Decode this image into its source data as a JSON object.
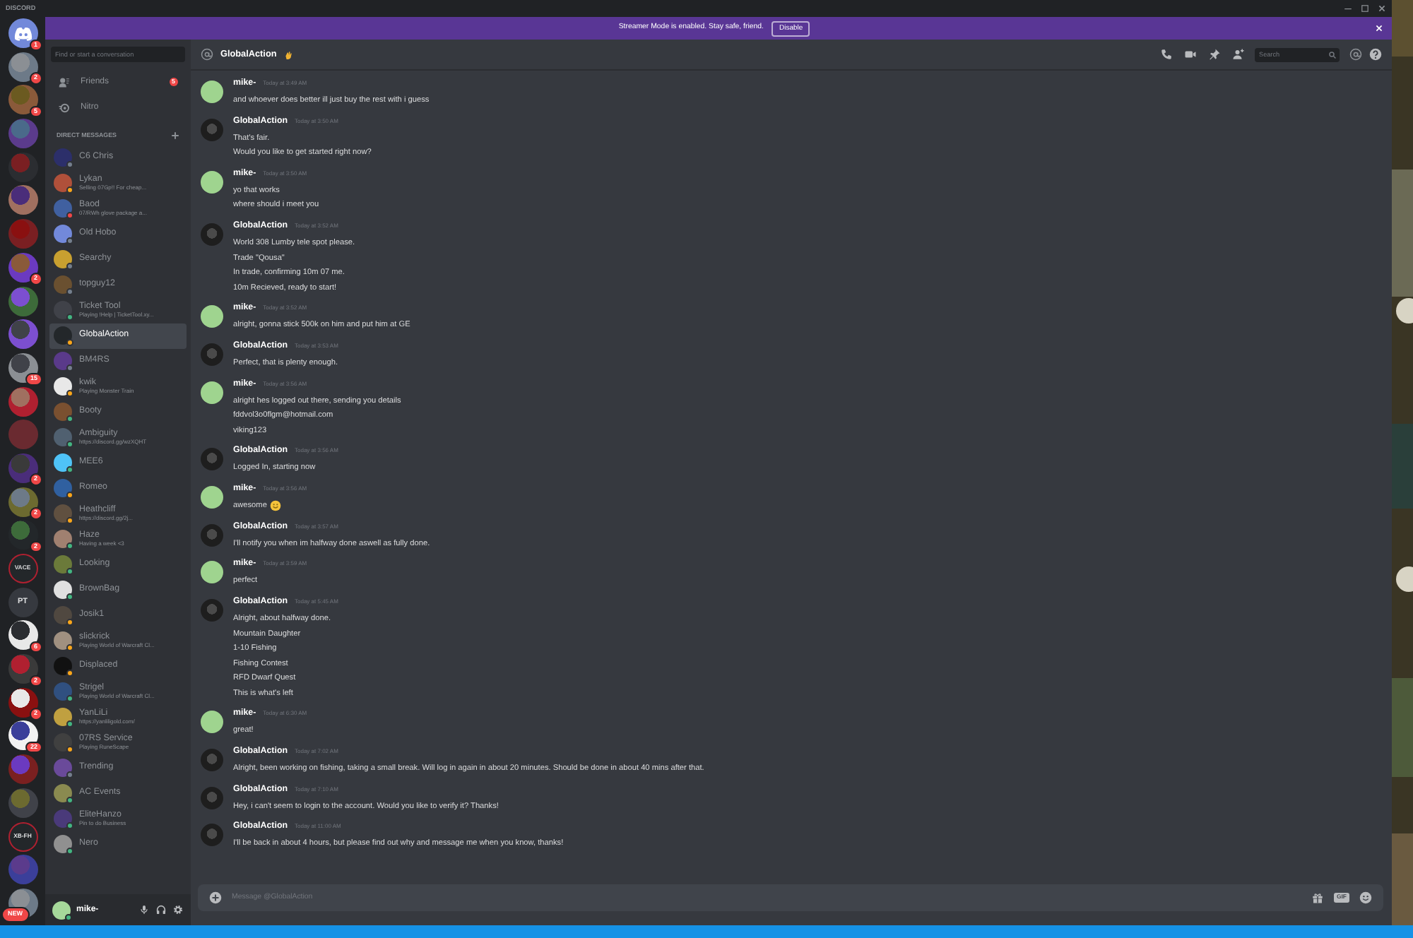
{
  "window": {
    "title": "DISCORD"
  },
  "servers": [
    {
      "kind": "home",
      "badge": "1"
    },
    {
      "kind": "picture",
      "badge": "2"
    },
    {
      "kind": "picture",
      "badge": "5"
    },
    {
      "kind": "picture"
    },
    {
      "kind": "picture"
    },
    {
      "kind": "picture"
    },
    {
      "kind": "picture"
    },
    {
      "kind": "picture",
      "badge": "2"
    },
    {
      "kind": "picture"
    },
    {
      "kind": "picture"
    },
    {
      "kind": "picture",
      "badge": "15"
    },
    {
      "kind": "picture"
    },
    {
      "kind": "picture"
    },
    {
      "kind": "picture",
      "badge": "2"
    },
    {
      "kind": "picture",
      "badge": "2"
    },
    {
      "kind": "picture",
      "badge": "2"
    },
    {
      "kind": "text",
      "label": "VACE"
    },
    {
      "kind": "text",
      "label": "PT"
    },
    {
      "kind": "picture",
      "badge": "6"
    },
    {
      "kind": "picture",
      "badge": "2"
    },
    {
      "kind": "picture",
      "badge": "2"
    },
    {
      "kind": "picture",
      "badge": "22"
    },
    {
      "kind": "picture"
    },
    {
      "kind": "picture"
    },
    {
      "kind": "text",
      "label": "XB-FH"
    },
    {
      "kind": "picture"
    },
    {
      "kind": "picture",
      "badge": "NEW"
    }
  ],
  "banner": {
    "text": "Streamer Mode is enabled. Stay safe, friend.",
    "button": "Disable"
  },
  "search": {
    "placeholder": "Find or start a conversation"
  },
  "nav": [
    {
      "kind": "friends",
      "label": "Friends",
      "badge": "5"
    },
    {
      "kind": "nitro",
      "label": "Nitro"
    }
  ],
  "dm_header": "DIRECT MESSAGES",
  "dms": [
    {
      "name": "C6 Chris",
      "color": "#747f8d",
      "selected": false
    },
    {
      "name": "Lykan",
      "activity": "Selling 07Gp!! For cheap...",
      "color": "#faa61a",
      "selected": false
    },
    {
      "name": "Baod",
      "activity": "07/RWh glove package a...",
      "color": "#f04747",
      "selected": false
    },
    {
      "name": "Old Hobo",
      "color": "#747f8d",
      "selected": false
    },
    {
      "name": "Searchy",
      "color": "#747f8d",
      "selected": false
    },
    {
      "name": "topguy12",
      "color": "#747f8d",
      "selected": false
    },
    {
      "name": "Ticket Tool",
      "activity": "Playing !Help | TicketTool.xy...",
      "color": "#43b581",
      "selected": false
    },
    {
      "name": "GlobalAction",
      "color": "#faa61a",
      "selected": true
    },
    {
      "name": "BM4RS",
      "color": "#747f8d",
      "selected": false
    },
    {
      "name": "kwik",
      "activity": "Playing Monster Train",
      "color": "#faa61a",
      "selected": false
    },
    {
      "name": "Booty",
      "color": "#43b581",
      "selected": false
    },
    {
      "name": "Ambiguity",
      "activity": "https://discord.gg/wzXQHT",
      "color": "#43b581",
      "selected": false
    },
    {
      "name": "MEE6",
      "color": "#43b581",
      "selected": false
    },
    {
      "name": "Romeo",
      "color": "#faa61a",
      "selected": false
    },
    {
      "name": "Heathcliff",
      "activity": "https://discord.gg/2j...",
      "color": "#faa61a",
      "selected": false
    },
    {
      "name": "Haze",
      "activity": "Having a week <3",
      "color": "#43b581",
      "selected": false
    },
    {
      "name": "Looking",
      "color": "#43b581",
      "selected": false
    },
    {
      "name": "BrownBag",
      "color": "#43b581",
      "selected": false
    },
    {
      "name": "Josik1",
      "color": "#faa61a",
      "selected": false
    },
    {
      "name": "slickrick",
      "activity": "Playing World of Warcraft Cl...",
      "color": "#faa61a",
      "selected": false
    },
    {
      "name": "Displaced",
      "color": "#faa61a",
      "selected": false
    },
    {
      "name": "Strigel",
      "activity": "Playing World of Warcraft Cl...",
      "color": "#43b581",
      "selected": false
    },
    {
      "name": "YanLiLi",
      "activity": "https://yanliligold.com/",
      "color": "#43b581",
      "selected": false
    },
    {
      "name": "07RS Service",
      "activity": "Playing RuneScape",
      "color": "#faa61a",
      "selected": false
    },
    {
      "name": "Trending",
      "color": "#747f8d",
      "selected": false
    },
    {
      "name": "AC Events",
      "color": "#43b581",
      "selected": false
    },
    {
      "name": "EliteHanzo",
      "activity": "Pin to do Business",
      "color": "#43b581",
      "selected": false
    },
    {
      "name": "Nero",
      "color": "#43b581",
      "selected": false
    }
  ],
  "user": {
    "name": "mike-"
  },
  "channel": {
    "name": "GlobalAction",
    "search_placeholder": "Search"
  },
  "messages": [
    {
      "author": "mike-",
      "kind": "self",
      "time": "Today at 3:49 AM",
      "lines": [
        "and whoever does better ill just buy the rest with i guess"
      ]
    },
    {
      "author": "GlobalAction",
      "kind": "other",
      "time": "Today at 3:50 AM",
      "lines": [
        "That's fair.",
        "Would you like to get started right now?"
      ]
    },
    {
      "author": "mike-",
      "kind": "self",
      "time": "Today at 3:50 AM",
      "lines": [
        "yo that works",
        "where should i meet you"
      ]
    },
    {
      "author": "GlobalAction",
      "kind": "other",
      "time": "Today at 3:52 AM",
      "lines": [
        "World 308 Lumby tele spot please.",
        "Trade \"Qousa\"",
        "In trade, confirming 10m 07 me.",
        "10m Recieved, ready to start!"
      ]
    },
    {
      "author": "mike-",
      "kind": "self",
      "time": "Today at 3:52 AM",
      "lines": [
        "alright, gonna stick 500k on him and put him at GE"
      ]
    },
    {
      "author": "GlobalAction",
      "kind": "other",
      "time": "Today at 3:53 AM",
      "lines": [
        "Perfect, that is plenty enough."
      ]
    },
    {
      "author": "mike-",
      "kind": "self",
      "time": "Today at 3:56 AM",
      "lines": [
        "alright hes logged out there, sending you details",
        "fddvol3o0flgm@hotmail.com",
        "viking123"
      ]
    },
    {
      "author": "GlobalAction",
      "kind": "other",
      "time": "Today at 3:56 AM",
      "lines": [
        "Logged In, starting now"
      ]
    },
    {
      "author": "mike-",
      "kind": "self",
      "time": "Today at 3:56 AM",
      "lines": [
        "awesome"
      ],
      "emoji": true
    },
    {
      "author": "GlobalAction",
      "kind": "other",
      "time": "Today at 3:57 AM",
      "lines": [
        "I'll notify you when im halfway done aswell as fully done."
      ]
    },
    {
      "author": "mike-",
      "kind": "self",
      "time": "Today at 3:59 AM",
      "lines": [
        "perfect"
      ]
    },
    {
      "author": "GlobalAction",
      "kind": "other",
      "time": "Today at 5:45 AM",
      "lines": [
        "Alright, about halfway done.",
        "Mountain Daughter",
        "1-10 Fishing",
        "Fishing Contest",
        "RFD Dwarf Quest",
        "This is what's left"
      ]
    },
    {
      "author": "mike-",
      "kind": "self",
      "time": "Today at 6:30 AM",
      "lines": [
        "great!"
      ]
    },
    {
      "author": "GlobalAction",
      "kind": "other",
      "time": "Today at 7:02 AM",
      "lines": [
        "Alright, been working on fishing, taking a small break. Will log in again in about 20 minutes. Should be done in about 40 mins after that."
      ]
    },
    {
      "author": "GlobalAction",
      "kind": "other",
      "time": "Today at 7:10 AM",
      "lines": [
        "Hey, i can't seem to login to the account. Would you like to verify it? Thanks!"
      ]
    },
    {
      "author": "GlobalAction",
      "kind": "other",
      "time": "Today at 11:00 AM",
      "lines": [
        "I'll be back in about 4 hours, but please find out why and message me when you know, thanks!"
      ]
    }
  ],
  "composer": {
    "placeholder": "Message @GlobalAction",
    "gif_label": "GIF"
  }
}
